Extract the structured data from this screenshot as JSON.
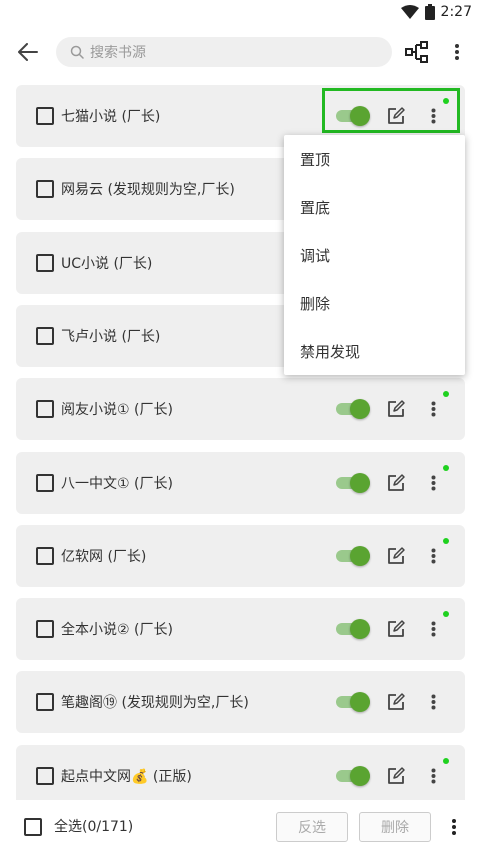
{
  "status": {
    "time": "2:27"
  },
  "search": {
    "placeholder": "搜索书源"
  },
  "items": [
    {
      "title": "七猫小说 (厂长)",
      "enabled": true,
      "has_dot": true
    },
    {
      "title": "网易云 (发现规则为空,厂长)",
      "enabled": true,
      "has_dot": false
    },
    {
      "title": "UC小说 (厂长)",
      "enabled": true,
      "has_dot": false
    },
    {
      "title": "飞卢小说 (厂长)",
      "enabled": true,
      "has_dot": false
    },
    {
      "title": "阅友小说① (厂长)",
      "enabled": true,
      "has_dot": true
    },
    {
      "title": "八一中文① (厂长)",
      "enabled": true,
      "has_dot": true
    },
    {
      "title": "亿软网 (厂长)",
      "enabled": true,
      "has_dot": true
    },
    {
      "title": "全本小说② (厂长)",
      "enabled": true,
      "has_dot": true
    },
    {
      "title": "笔趣阁⑲ (发现规则为空,厂长)",
      "enabled": true,
      "has_dot": false
    },
    {
      "title": "起点中文网💰 (正版)",
      "enabled": true,
      "has_dot": true
    }
  ],
  "menu": {
    "items": [
      "置顶",
      "置底",
      "调试",
      "删除",
      "禁用发现"
    ]
  },
  "bottom": {
    "select_all_label": "全选(0/171)",
    "invert_label": "反选",
    "delete_label": "删除"
  },
  "colors": {
    "accent_green": "#5aa431",
    "switch_track": "#9ac98c",
    "dot_green": "#1fd11f",
    "highlight_green": "#22b922"
  }
}
